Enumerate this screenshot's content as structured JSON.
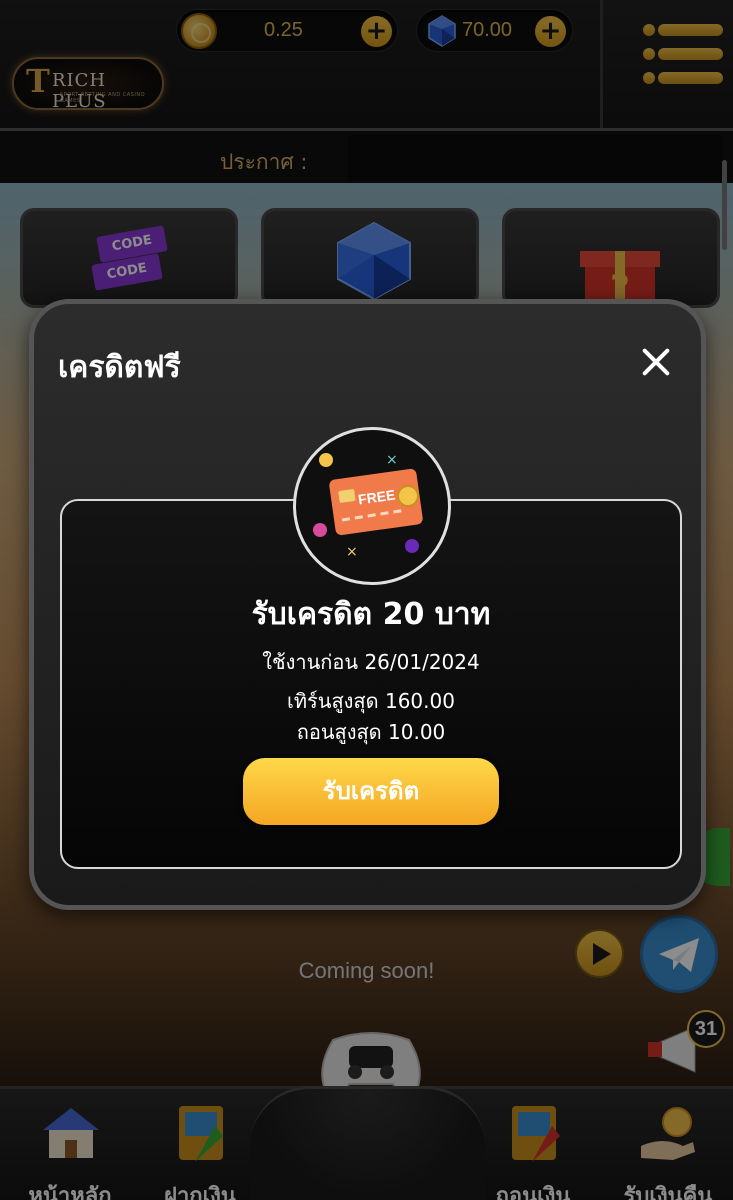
{
  "header": {
    "brand_text": "RICH PLUS",
    "brand_tagline": "SPORT BETTING AND CASINO GAMES",
    "coin_balance": "0.25",
    "gem_balance": "70.00",
    "plus_symbol": "+"
  },
  "announcement": {
    "label": "ประกาศ :"
  },
  "promo_tiles": [
    {
      "name": "code-coupon-tile",
      "icon": "coupon-icon",
      "code_text": "CODE"
    },
    {
      "name": "diamond-tile",
      "icon": "diamond-icon"
    },
    {
      "name": "mystery-gift-tile",
      "icon": "gift-box-icon"
    }
  ],
  "coming_soon": "Coming soon!",
  "promo_badge_count": "31",
  "bottom_nav": [
    {
      "label": "หน้าหลัก",
      "icon": "home-icon"
    },
    {
      "label": "ฝากเงิน",
      "icon": "deposit-icon"
    },
    {
      "label": "ถอนเงิน",
      "icon": "withdraw-icon"
    },
    {
      "label": "รับเงินคืน",
      "icon": "cashback-icon"
    }
  ],
  "modal": {
    "title": "เครดิตฟรี",
    "badge_text": "FREE",
    "heading": "รับเครดิต 20 บาท",
    "use_before": "ใช้งานก่อน 26/01/2024",
    "max_turnover": "เทิร์นสูงสุด 160.00",
    "max_withdraw": "ถอนสูงสุด 10.00",
    "claim_button": "รับเครดิต"
  },
  "colors": {
    "accent_gold": "#f0c04a",
    "button_gradient_top": "#ffd84a",
    "button_gradient_bottom": "#f5a623",
    "telegram_blue": "#3a8fd0"
  }
}
